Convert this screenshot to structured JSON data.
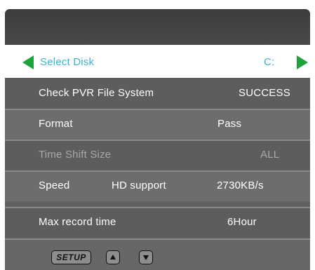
{
  "colors": {
    "panel_background": "#616161",
    "header_background": "#444444",
    "selected_row_background": "#ffffff",
    "selected_text": "#39b6d3",
    "arrow_color": "#1ea23e",
    "normal_text": "#ffffff",
    "disabled_text": "#a9a9a9"
  },
  "select_disk": {
    "label": "Select Disk",
    "value": "C:",
    "left_icon": "triangle-left-icon",
    "right_icon": "triangle-right-icon"
  },
  "rows": [
    {
      "label": "Check PVR File System",
      "value": "SUCCESS"
    },
    {
      "label": "Format",
      "value": "Pass"
    },
    {
      "label": "Time Shift Size",
      "value": "ALL",
      "disabled": true
    },
    {
      "label": "Speed",
      "middle": "HD support",
      "value": "2730KB/s"
    },
    {
      "label": "Max record time",
      "value": "6Hour"
    }
  ],
  "footer": {
    "setup_key": "SETUP",
    "up_icon": "triangle-up-icon",
    "down_icon": "triangle-down-icon"
  }
}
